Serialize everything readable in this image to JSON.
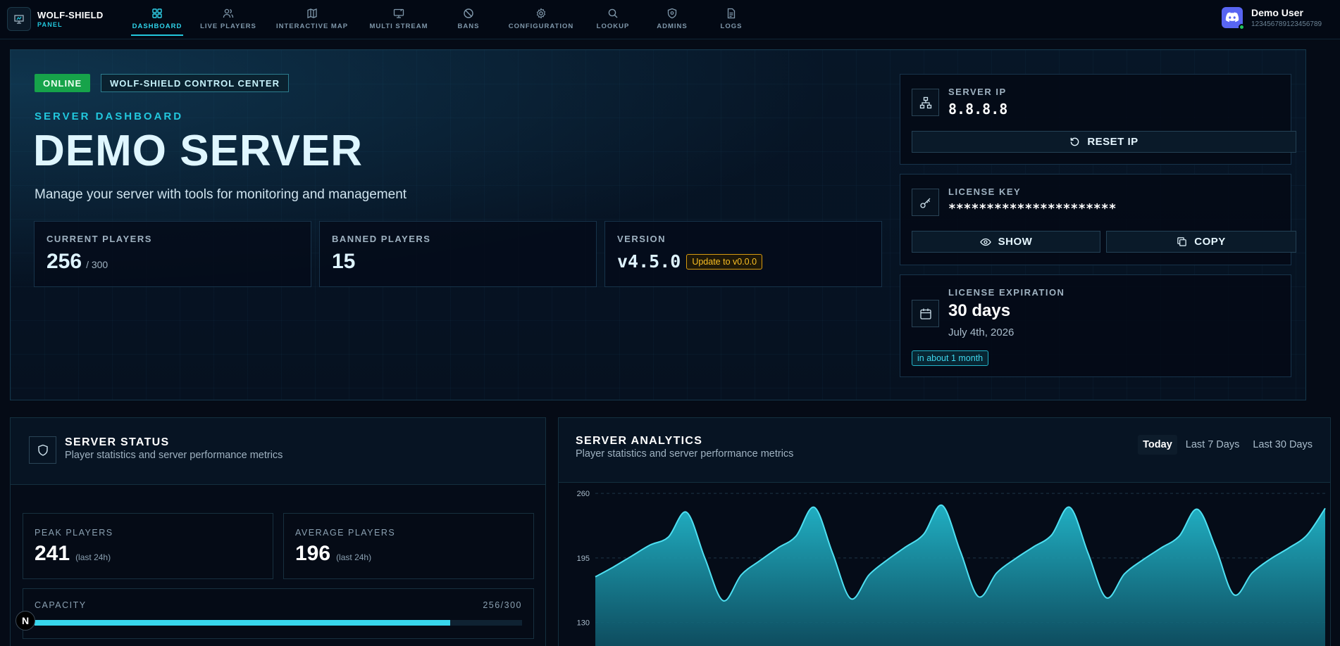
{
  "brand": {
    "title": "WOLF-SHIELD",
    "subtitle": "PANEL"
  },
  "nav": [
    {
      "label": "DASHBOARD",
      "icon": "dashboard-icon",
      "active": true
    },
    {
      "label": "LIVE PLAYERS",
      "icon": "users-icon"
    },
    {
      "label": "INTERACTIVE MAP",
      "icon": "map-icon"
    },
    {
      "label": "MULTI STREAM",
      "icon": "monitor-icon"
    },
    {
      "label": "BANS",
      "icon": "ban-icon"
    },
    {
      "label": "CONFIGURATION",
      "icon": "gear-icon"
    },
    {
      "label": "LOOKUP",
      "icon": "search-icon"
    },
    {
      "label": "ADMINS",
      "icon": "shield-gear-icon"
    },
    {
      "label": "LOGS",
      "icon": "document-icon"
    }
  ],
  "user": {
    "name": "Demo User",
    "id": "1234567891234567​89",
    "avatar_icon": "discord-icon"
  },
  "hero": {
    "status_badge": "ONLINE",
    "center_badge": "WOLF-SHIELD CONTROL CENTER",
    "eyebrow": "SERVER DASHBOARD",
    "title": "DEMO SERVER",
    "description": "Manage your server with tools for monitoring and management",
    "stats": {
      "current_label": "CURRENT PLAYERS",
      "current_value": "256",
      "current_max": "/ 300",
      "banned_label": "BANNED PLAYERS",
      "banned_value": "15",
      "version_label": "VERSION",
      "version_value": "v4.5.0",
      "update_label": "Update to v0.0.0"
    }
  },
  "server_ip": {
    "label": "SERVER IP",
    "value": "8.8.8.8",
    "reset_label": "RESET IP"
  },
  "license": {
    "label": "LICENSE KEY",
    "value": "**********************",
    "show_label": "SHOW",
    "copy_label": "COPY"
  },
  "expiration": {
    "label": "LICENSE EXPIRATION",
    "value": "30 days",
    "date": "July 4th, 2026",
    "relative": "in about 1 month"
  },
  "status_panel": {
    "title": "SERVER STATUS",
    "subtitle": "Player statistics and server performance metrics",
    "peak_label": "PEAK PLAYERS",
    "peak_value": "241",
    "peak_note": "(last 24h)",
    "avg_label": "AVERAGE PLAYERS",
    "avg_value": "196",
    "avg_note": "(last 24h)",
    "capacity_label": "CAPACITY",
    "capacity_count": "256/300",
    "capacity_fraction": 0.853
  },
  "analytics": {
    "title": "SERVER ANALYTICS",
    "subtitle": "Player statistics and server performance metrics",
    "ranges": [
      "Today",
      "Last 7 Days",
      "Last 30 Days"
    ],
    "active_range": "Today"
  },
  "colors": {
    "accent": "#22c7dd",
    "online": "#16a34a",
    "warning": "#fbbf24",
    "background": "#050b16"
  },
  "chart_data": {
    "type": "area",
    "title": "",
    "xlabel": "",
    "ylabel": "",
    "y_ticks": [
      260,
      195,
      130
    ],
    "ylim": [
      100,
      270
    ],
    "grid": true,
    "x": [
      0,
      1,
      2,
      3,
      4,
      5,
      6,
      7,
      8,
      9,
      10,
      11,
      12,
      13,
      14,
      15,
      16,
      17,
      18,
      19,
      20,
      21,
      22,
      23,
      24,
      25,
      26,
      27,
      28,
      29,
      30,
      31,
      32,
      33,
      34,
      35,
      36,
      37,
      38,
      39,
      40
    ],
    "series": [
      {
        "values": [
          176,
          186,
          197,
          208,
          216,
          241,
          195,
          152,
          178,
          192,
          205,
          217,
          246,
          200,
          154,
          178,
          193,
          206,
          219,
          248,
          202,
          156,
          180,
          194,
          206,
          218,
          246,
          200,
          155,
          179,
          193,
          205,
          217,
          244,
          205,
          158,
          180,
          194,
          205,
          218,
          245
        ]
      }
    ]
  }
}
